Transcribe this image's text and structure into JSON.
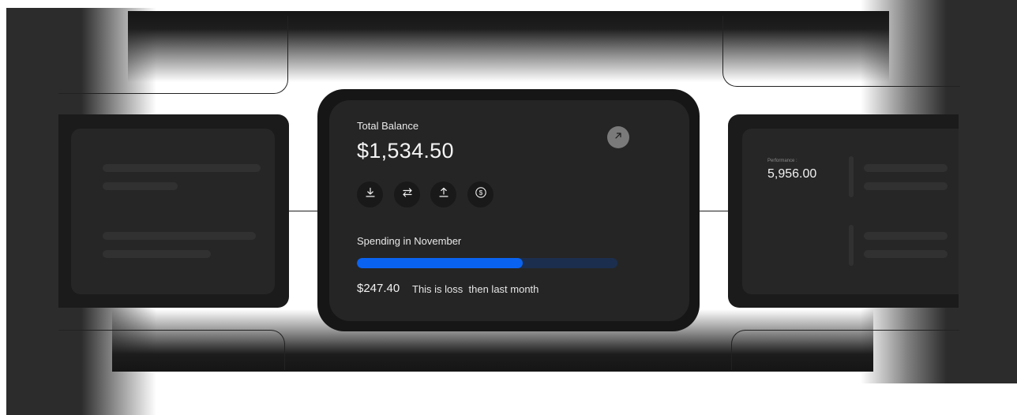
{
  "balance_card": {
    "title": "Total Balance",
    "amount": "$1,534.50",
    "expand_icon": "arrow-up-right-icon",
    "actions": [
      {
        "icon": "download-icon"
      },
      {
        "icon": "transfer-icon"
      },
      {
        "icon": "upload-icon"
      },
      {
        "icon": "dollar-icon"
      }
    ],
    "spending": {
      "label": "Spending in November",
      "progress_fraction": 0.635,
      "amount": "$247.40",
      "note": "This is loss  then last month"
    }
  },
  "performance_card": {
    "label": "Performance :",
    "value": "5,956.00"
  },
  "colors": {
    "accent": "#0a63f0",
    "progress_track": "#1c2e4d",
    "card_bg": "#252525",
    "card_border": "#161616"
  }
}
